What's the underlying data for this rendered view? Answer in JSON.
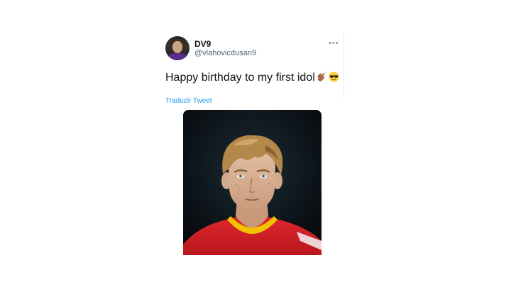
{
  "tweet": {
    "display_name": "DV9",
    "handle": "@vlahovicdusan9",
    "more_label": "•••",
    "text": "Happy birthday to my first idol",
    "emojis": [
      "clapping-hands-icon",
      "smiling-face-with-sunglasses-icon"
    ],
    "translate_label": "Traducir Tweet"
  },
  "colors": {
    "link": "#1d9bf0",
    "text": "#0f1419",
    "secondary": "#536471",
    "jersey": "#d21f27",
    "collar": "#f2c200"
  }
}
